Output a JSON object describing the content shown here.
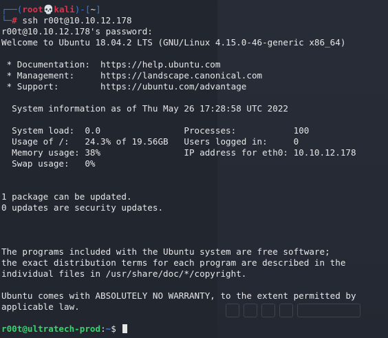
{
  "prompt": {
    "corner_top": "┌──(",
    "user": "root",
    "skull": "💀",
    "host": "kali",
    "bracket_mid": ")-[",
    "dir": "~",
    "bracket_end": "]",
    "corner_bottom": "└─",
    "hash": "#",
    "command": " ssh r00t@10.10.12.178"
  },
  "output": {
    "password_prompt": "r00t@10.10.12.178's password:",
    "welcome": "Welcome to Ubuntu 18.04.2 LTS (GNU/Linux 4.15.0-46-generic x86_64)",
    "doc": " * Documentation:  https://help.ubuntu.com",
    "mgmt": " * Management:     https://landscape.canonical.com",
    "support": " * Support:        https://ubuntu.com/advantage",
    "sysinfo": "  System information as of Thu May 26 17:28:58 UTC 2022",
    "row1": "  System load:  0.0                Processes:           100",
    "row2": "  Usage of /:   24.3% of 19.56GB   Users logged in:     0",
    "row3": "  Memory usage: 38%                IP address for eth0: 10.10.12.178",
    "row4": "  Swap usage:   0%",
    "pkg1": "1 package can be updated.",
    "pkg2": "0 updates are security updates.",
    "free1": "The programs included with the Ubuntu system are free software;",
    "free2": "the exact distribution terms for each program are described in the",
    "free3": "individual files in /usr/share/doc/*/copyright.",
    "warranty1": "Ubuntu comes with ABSOLUTELY NO WARRANTY, to the extent permitted by",
    "warranty2": "applicable law."
  },
  "remote_prompt": {
    "userhost": "r00t@ultratech-prod",
    "colon": ":",
    "path": "~",
    "dollar": "$ "
  },
  "colors": {
    "background": "#22262f",
    "prompt_blue": "#3a7bd5",
    "prompt_red": "#e0304a",
    "remote_green": "#39d46e",
    "text": "#e6e6e6"
  }
}
